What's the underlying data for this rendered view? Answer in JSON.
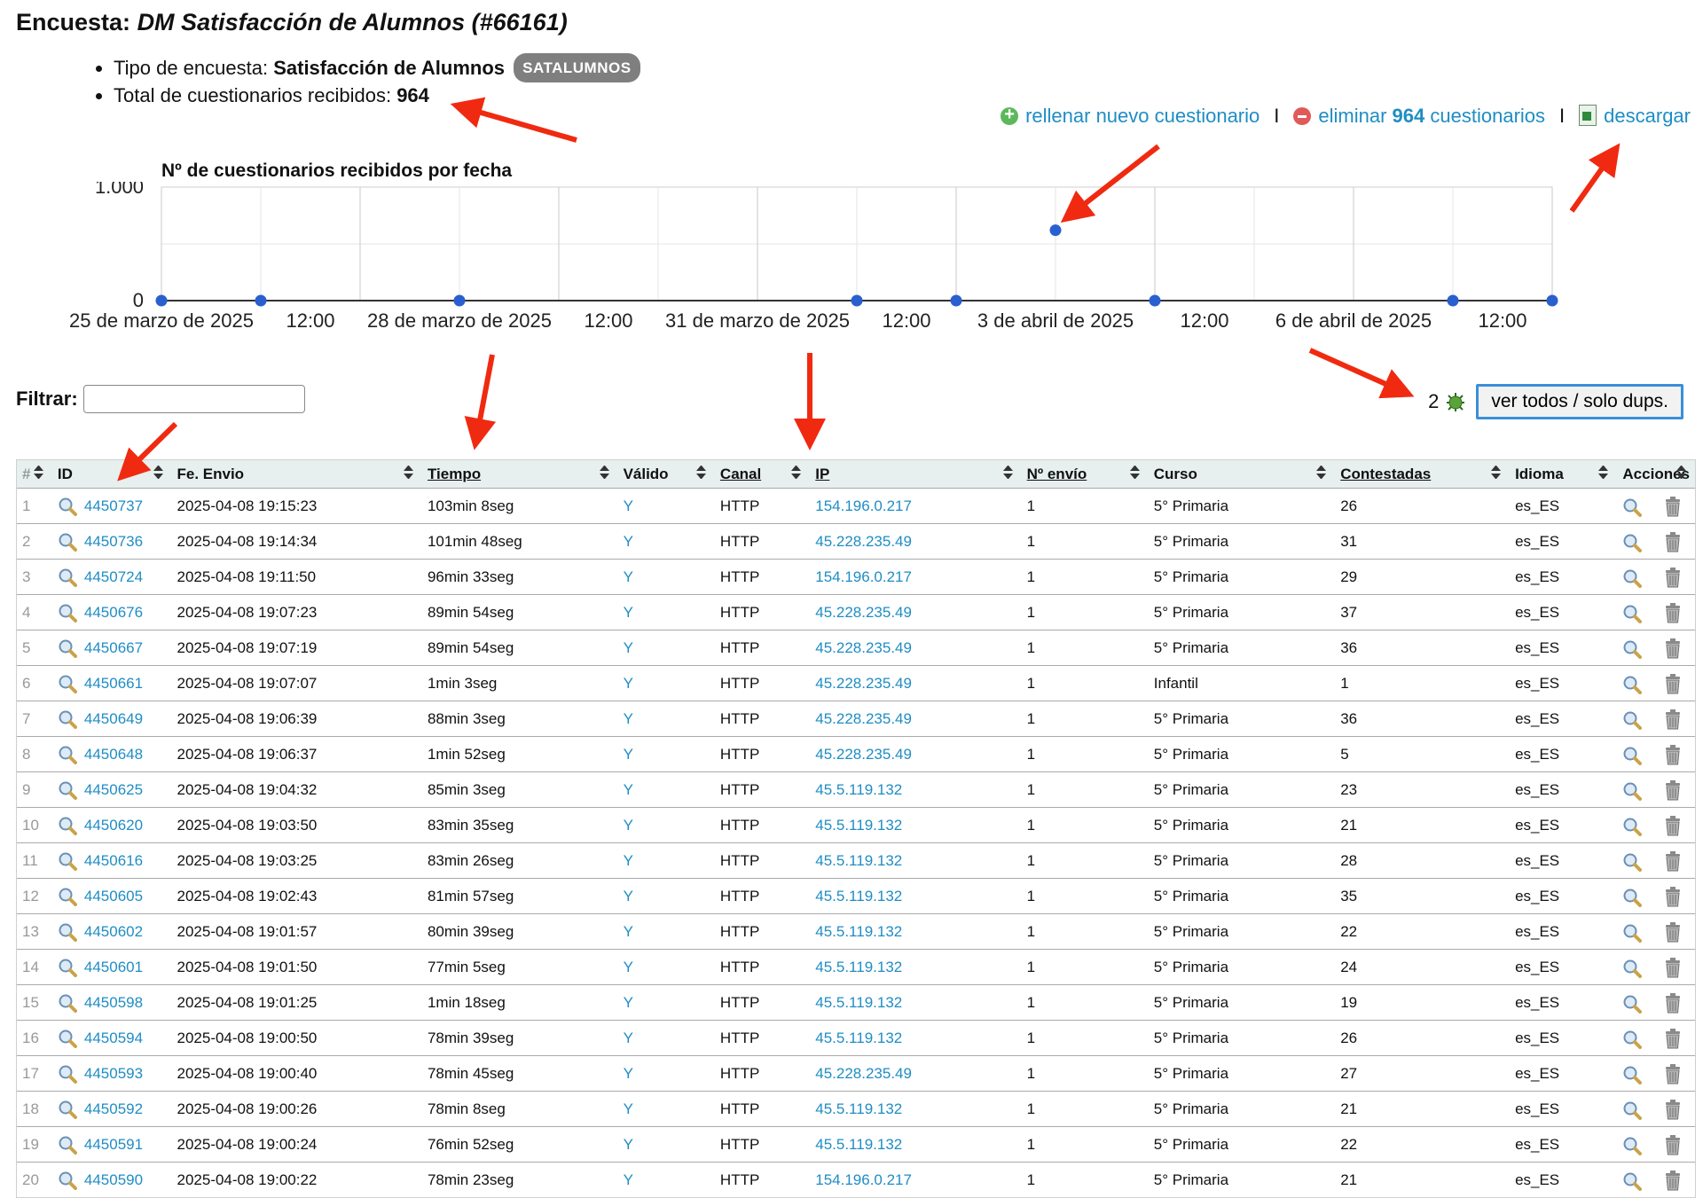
{
  "header": {
    "prefix": "Encuesta:",
    "name": "DM Satisfacción de Alumnos (#66161)",
    "type_label": "Tipo de encuesta:",
    "type_value": "Satisfacción de Alumnos",
    "type_badge": "SATALUMNOS",
    "total_label": "Total de cuestionarios recibidos:",
    "total_value": "964"
  },
  "actions": {
    "new_label": "rellenar nuevo cuestionario",
    "delete_prefix": "eliminar",
    "delete_count": "964",
    "delete_suffix": "cuestionarios",
    "download_label": "descargar",
    "separator": "I"
  },
  "chart_data": {
    "type": "scatter",
    "title": "Nº de cuestionarios recibidos por fecha",
    "ylim": [
      0,
      1000
    ],
    "ytick_labels": [
      "0",
      "1.000"
    ],
    "xtick_labels": [
      "25 de marzo de 2025",
      "12:00",
      "28 de marzo de 2025",
      "12:00",
      "31 de marzo de 2025",
      "12:00",
      "3 de abril de 2025",
      "12:00",
      "6 de abril de 2025",
      "12:00"
    ],
    "points": [
      {
        "x": "25 de marzo de 2025",
        "y": 0
      },
      {
        "x": "26 de marzo de 2025",
        "y": 0
      },
      {
        "x": "28 de marzo de 2025",
        "y": 0
      },
      {
        "x": "1 de abril de 2025",
        "y": 0
      },
      {
        "x": "2 de abril de 2025",
        "y": 0
      },
      {
        "x": "3 de abril de 2025",
        "y": 620
      },
      {
        "x": "4 de abril de 2025",
        "y": 0
      },
      {
        "x": "7 de abril de 2025",
        "y": 0
      },
      {
        "x": "8 de abril de 2025",
        "y": 0
      }
    ],
    "grid": true,
    "point_color": "#2a5fcf"
  },
  "filter": {
    "label": "Filtrar:",
    "value": ""
  },
  "dups": {
    "count": "2",
    "button_label": "ver todos / solo dups."
  },
  "table": {
    "columns": [
      "#",
      "ID",
      "Fe. Envio",
      "Tiempo",
      "Válido",
      "Canal",
      "IP",
      "Nº envío",
      "Curso",
      "Contestadas",
      "Idioma",
      "Acciones"
    ],
    "rows": [
      [
        "1",
        "4450737",
        "2025-04-08 19:15:23",
        "103min 8seg",
        "Y",
        "HTTP",
        "154.196.0.217",
        "1",
        "5° Primaria",
        "26",
        "es_ES"
      ],
      [
        "2",
        "4450736",
        "2025-04-08 19:14:34",
        "101min 48seg",
        "Y",
        "HTTP",
        "45.228.235.49",
        "1",
        "5° Primaria",
        "31",
        "es_ES"
      ],
      [
        "3",
        "4450724",
        "2025-04-08 19:11:50",
        "96min 33seg",
        "Y",
        "HTTP",
        "154.196.0.217",
        "1",
        "5° Primaria",
        "29",
        "es_ES"
      ],
      [
        "4",
        "4450676",
        "2025-04-08 19:07:23",
        "89min 54seg",
        "Y",
        "HTTP",
        "45.228.235.49",
        "1",
        "5° Primaria",
        "37",
        "es_ES"
      ],
      [
        "5",
        "4450667",
        "2025-04-08 19:07:19",
        "89min 54seg",
        "Y",
        "HTTP",
        "45.228.235.49",
        "1",
        "5° Primaria",
        "36",
        "es_ES"
      ],
      [
        "6",
        "4450661",
        "2025-04-08 19:07:07",
        "1min 3seg",
        "Y",
        "HTTP",
        "45.228.235.49",
        "1",
        "Infantil",
        "1",
        "es_ES"
      ],
      [
        "7",
        "4450649",
        "2025-04-08 19:06:39",
        "88min 3seg",
        "Y",
        "HTTP",
        "45.228.235.49",
        "1",
        "5° Primaria",
        "36",
        "es_ES"
      ],
      [
        "8",
        "4450648",
        "2025-04-08 19:06:37",
        "1min 52seg",
        "Y",
        "HTTP",
        "45.228.235.49",
        "1",
        "5° Primaria",
        "5",
        "es_ES"
      ],
      [
        "9",
        "4450625",
        "2025-04-08 19:04:32",
        "85min 3seg",
        "Y",
        "HTTP",
        "45.5.119.132",
        "1",
        "5° Primaria",
        "23",
        "es_ES"
      ],
      [
        "10",
        "4450620",
        "2025-04-08 19:03:50",
        "83min 35seg",
        "Y",
        "HTTP",
        "45.5.119.132",
        "1",
        "5° Primaria",
        "21",
        "es_ES"
      ],
      [
        "11",
        "4450616",
        "2025-04-08 19:03:25",
        "83min 26seg",
        "Y",
        "HTTP",
        "45.5.119.132",
        "1",
        "5° Primaria",
        "28",
        "es_ES"
      ],
      [
        "12",
        "4450605",
        "2025-04-08 19:02:43",
        "81min 57seg",
        "Y",
        "HTTP",
        "45.5.119.132",
        "1",
        "5° Primaria",
        "35",
        "es_ES"
      ],
      [
        "13",
        "4450602",
        "2025-04-08 19:01:57",
        "80min 39seg",
        "Y",
        "HTTP",
        "45.5.119.132",
        "1",
        "5° Primaria",
        "22",
        "es_ES"
      ],
      [
        "14",
        "4450601",
        "2025-04-08 19:01:50",
        "77min 5seg",
        "Y",
        "HTTP",
        "45.5.119.132",
        "1",
        "5° Primaria",
        "24",
        "es_ES"
      ],
      [
        "15",
        "4450598",
        "2025-04-08 19:01:25",
        "1min 18seg",
        "Y",
        "HTTP",
        "45.5.119.132",
        "1",
        "5° Primaria",
        "19",
        "es_ES"
      ],
      [
        "16",
        "4450594",
        "2025-04-08 19:00:50",
        "78min 39seg",
        "Y",
        "HTTP",
        "45.5.119.132",
        "1",
        "5° Primaria",
        "26",
        "es_ES"
      ],
      [
        "17",
        "4450593",
        "2025-04-08 19:00:40",
        "78min 45seg",
        "Y",
        "HTTP",
        "45.228.235.49",
        "1",
        "5° Primaria",
        "27",
        "es_ES"
      ],
      [
        "18",
        "4450592",
        "2025-04-08 19:00:26",
        "78min 8seg",
        "Y",
        "HTTP",
        "45.5.119.132",
        "1",
        "5° Primaria",
        "21",
        "es_ES"
      ],
      [
        "19",
        "4450591",
        "2025-04-08 19:00:24",
        "76min 52seg",
        "Y",
        "HTTP",
        "45.5.119.132",
        "1",
        "5° Primaria",
        "22",
        "es_ES"
      ],
      [
        "20",
        "4450590",
        "2025-04-08 19:00:22",
        "78min 23seg",
        "Y",
        "HTTP",
        "154.196.0.217",
        "1",
        "5° Primaria",
        "21",
        "es_ES"
      ]
    ]
  },
  "colors": {
    "link": "#1f8dc4",
    "annotation_arrow": "#f02a10",
    "header_bg": "#e7efef"
  }
}
